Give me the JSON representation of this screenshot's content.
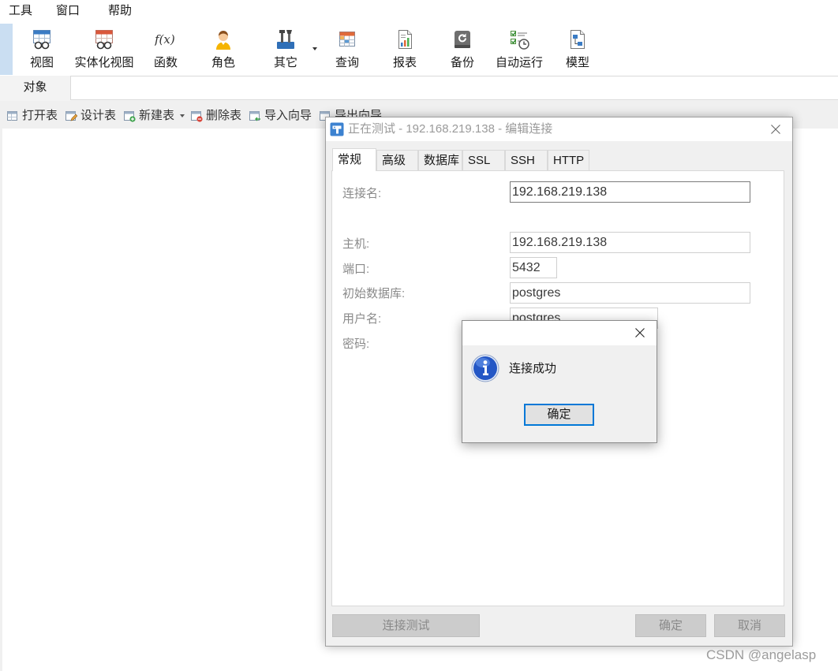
{
  "menu": {
    "items": [
      {
        "label": "工具"
      },
      {
        "label": "窗口"
      },
      {
        "label": "帮助"
      }
    ]
  },
  "toolbar": {
    "items": [
      {
        "label": "视图",
        "icon": "view-icon"
      },
      {
        "label": "实体化视图",
        "icon": "materialized-view-icon"
      },
      {
        "label": "函数",
        "icon": "function-icon",
        "glyph": "f(x)"
      },
      {
        "label": "角色",
        "icon": "role-icon"
      },
      {
        "label": "其它",
        "icon": "tools-icon",
        "has_dropdown": true
      },
      {
        "label": "查询",
        "icon": "query-icon"
      },
      {
        "label": "报表",
        "icon": "report-icon"
      },
      {
        "label": "备份",
        "icon": "backup-icon"
      },
      {
        "label": "自动运行",
        "icon": "automation-icon"
      },
      {
        "label": "模型",
        "icon": "model-icon"
      }
    ]
  },
  "object_tabs": {
    "items": [
      {
        "label": "对象",
        "active": true
      }
    ]
  },
  "object_toolbar": {
    "items": [
      {
        "label": "打开表",
        "icon": "open-table-icon"
      },
      {
        "label": "设计表",
        "icon": "design-table-icon"
      },
      {
        "label": "新建表",
        "icon": "new-table-icon",
        "has_dropdown": true
      },
      {
        "label": "删除表",
        "icon": "delete-table-icon"
      },
      {
        "label": "导入向导",
        "icon": "import-wizard-icon"
      },
      {
        "label": "导出向导",
        "icon": "export-wizard-icon"
      }
    ]
  },
  "dialog": {
    "title": "正在测试 - 192.168.219.138 - 编辑连接",
    "icon": "navicat-app-icon",
    "tabs": [
      {
        "label": "常规",
        "active": true
      },
      {
        "label": "高级"
      },
      {
        "label": "数据库"
      },
      {
        "label": "SSL"
      },
      {
        "label": "SSH"
      },
      {
        "label": "HTTP"
      }
    ],
    "fields": {
      "connection_name": {
        "label": "连接名:",
        "value": "192.168.219.138"
      },
      "host": {
        "label": "主机:",
        "value": "192.168.219.138"
      },
      "port": {
        "label": "端口:",
        "value": "5432"
      },
      "initial_database": {
        "label": "初始数据库:",
        "value": "postgres"
      },
      "username": {
        "label": "用户名:",
        "value": "postgres"
      },
      "password": {
        "label": "密码:"
      }
    },
    "buttons": {
      "test_connection": "连接测试",
      "ok": "确定",
      "cancel": "取消"
    }
  },
  "message_box": {
    "icon": "info-icon",
    "message": "连接成功",
    "ok": "确定"
  },
  "colors": {
    "accent": "#0078d7",
    "dialog_background": "#f0f0f0",
    "disabled_button": "#cccccc"
  },
  "watermark": "CSDN @angelasp"
}
